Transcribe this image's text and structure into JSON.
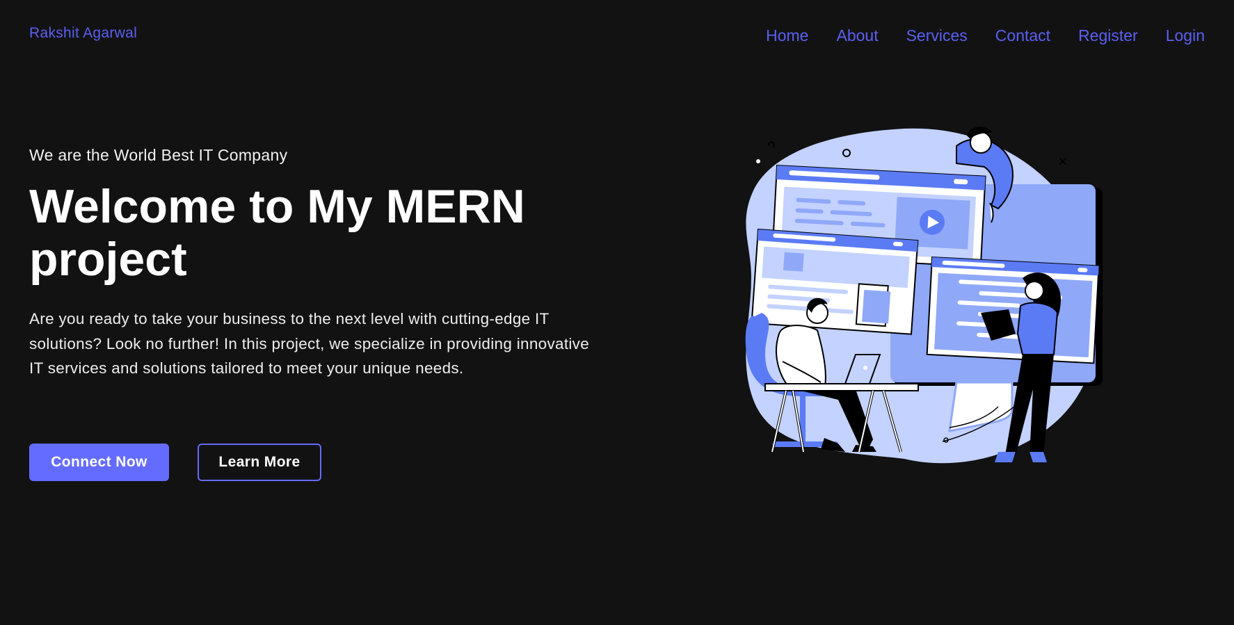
{
  "header": {
    "brand": "Rakshit Agarwal",
    "nav": [
      "Home",
      "About",
      "Services",
      "Contact",
      "Register",
      "Login"
    ]
  },
  "hero": {
    "tagline": "We are the World Best IT Company",
    "title": "Welcome to My MERN project",
    "description": "Are you ready to take your business to the next level with cutting-edge IT solutions? Look no further! In this project, we specialize in providing innovative IT services and solutions tailored to meet your unique needs.",
    "buttons": {
      "primary": "Connect Now",
      "secondary": "Learn More"
    }
  },
  "colors": {
    "background": "#121213",
    "accent": "#646cff",
    "nav_text": "#5b60f0"
  }
}
